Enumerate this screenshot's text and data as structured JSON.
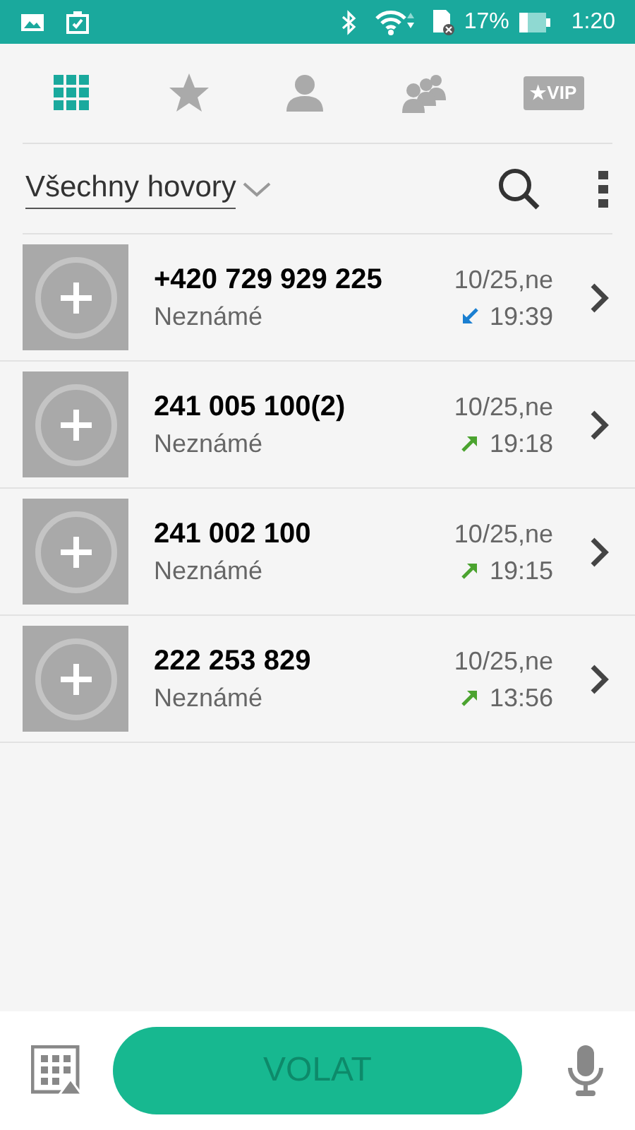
{
  "status_bar": {
    "battery": "17%",
    "time": "1:20"
  },
  "tabs": [
    {
      "kind": "dialpad",
      "selected": true
    },
    {
      "kind": "favorites",
      "selected": false
    },
    {
      "kind": "contacts",
      "selected": false
    },
    {
      "kind": "groups",
      "selected": false
    },
    {
      "kind": "vip",
      "label": "★VIP",
      "selected": false
    }
  ],
  "filter": {
    "label": "Všechny hovory"
  },
  "calls": [
    {
      "number": "+420 729 929 225",
      "label": "Neznámé",
      "date": "10/25,ne",
      "time": "19:39",
      "kind": "incoming"
    },
    {
      "number": "241 005 100(2)",
      "label": "Neznámé",
      "date": "10/25,ne",
      "time": "19:18",
      "kind": "outgoing"
    },
    {
      "number": "241 002 100",
      "label": "Neznámé",
      "date": "10/25,ne",
      "time": "19:15",
      "kind": "outgoing"
    },
    {
      "number": "222 253 829",
      "label": "Neznámé",
      "date": "10/25,ne",
      "time": "13:56",
      "kind": "outgoing"
    }
  ],
  "call_button": {
    "label": "VOLAT",
    "disabled": true
  }
}
